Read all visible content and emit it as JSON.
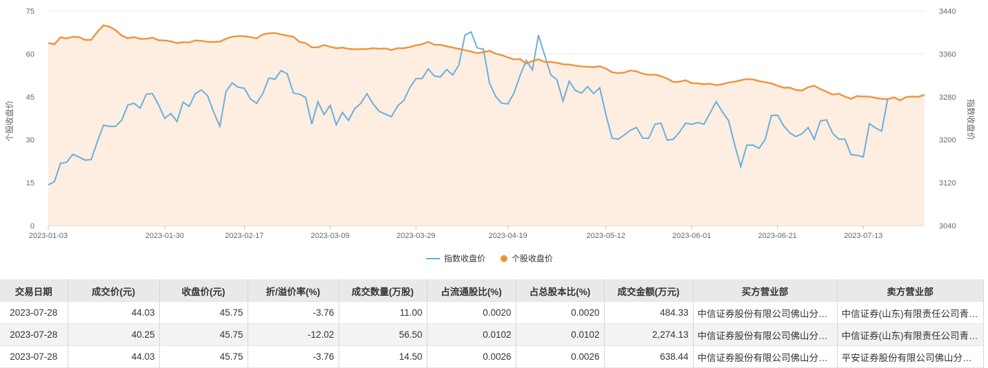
{
  "chart_data": {
    "type": "line",
    "x_tick_labels": [
      "2023-01-03",
      "2023-01-30",
      "2023-02-17",
      "2023-03-09",
      "2023-03-29",
      "2023-04-19",
      "2023-05-12",
      "2023-06-01",
      "2023-06-21",
      "2023-07-13"
    ],
    "y_left": {
      "label": "个股收盘价",
      "ticks": [
        "0",
        "15",
        "30",
        "45",
        "60",
        "75"
      ],
      "range": [
        0,
        75
      ]
    },
    "y_right": {
      "label": "指数收盘价",
      "ticks": [
        "3040",
        "3120",
        "3200",
        "3280",
        "3360",
        "3440"
      ],
      "range": [
        3040,
        3440
      ]
    },
    "grid": true,
    "legend_position": "bottom-center",
    "series": [
      {
        "name": "指数收盘价",
        "axis": "right",
        "color": "#6aaede",
        "values": [
          3116,
          3122,
          3156,
          3158,
          3173,
          3168,
          3162,
          3163,
          3196,
          3227,
          3225,
          3225,
          3237,
          3265,
          3268,
          3259,
          3285,
          3286,
          3265,
          3240,
          3249,
          3234,
          3270,
          3262,
          3286,
          3293,
          3282,
          3251,
          3225,
          3290,
          3306,
          3298,
          3296,
          3276,
          3268,
          3286,
          3315,
          3313,
          3329,
          3323,
          3287,
          3285,
          3279,
          3229,
          3271,
          3247,
          3264,
          3228,
          3251,
          3236,
          3258,
          3268,
          3286,
          3267,
          3253,
          3248,
          3243,
          3263,
          3273,
          3297,
          3314,
          3314,
          3332,
          3319,
          3317,
          3331,
          3321,
          3339,
          3395,
          3401,
          3371,
          3369,
          3306,
          3281,
          3268,
          3267,
          3287,
          3320,
          3348,
          3330,
          3395,
          3358,
          3321,
          3312,
          3272,
          3309,
          3292,
          3287,
          3299,
          3286,
          3297,
          3247,
          3203,
          3201,
          3209,
          3218,
          3223,
          3203,
          3203,
          3229,
          3231,
          3199,
          3201,
          3214,
          3231,
          3229,
          3232,
          3229,
          3250,
          3271,
          3252,
          3236,
          3191,
          3150,
          3190,
          3190,
          3184,
          3201,
          3245,
          3246,
          3226,
          3213,
          3206,
          3211,
          3223,
          3201,
          3235,
          3237,
          3212,
          3201,
          3201,
          3172,
          3171,
          3168,
          3230,
          3222,
          3216,
          3278
        ]
      },
      {
        "name": "个股收盘价",
        "axis": "left",
        "color": "#f0923a",
        "values": [
          63.8,
          63.4,
          65.8,
          65.4,
          66.0,
          65.9,
          64.9,
          64.9,
          67.7,
          70.0,
          69.5,
          68.3,
          66.4,
          65.5,
          65.9,
          65.3,
          65.3,
          65.7,
          64.8,
          64.7,
          64.4,
          63.8,
          64.1,
          64.0,
          64.7,
          64.6,
          64.2,
          64.2,
          64.3,
          65.3,
          66.0,
          66.2,
          66.2,
          65.9,
          65.4,
          66.8,
          67.2,
          67.3,
          66.8,
          66.4,
          66.0,
          64.2,
          63.8,
          62.3,
          62.3,
          63.1,
          62.5,
          62.0,
          62.2,
          61.8,
          61.6,
          61.7,
          61.7,
          62.0,
          61.8,
          61.9,
          61.4,
          62.0,
          62.0,
          62.4,
          63.0,
          63.4,
          64.2,
          63.2,
          63.2,
          62.7,
          62.2,
          61.8,
          61.3,
          60.8,
          60.3,
          60.6,
          61.1,
          60.1,
          59.6,
          58.8,
          58.1,
          58.2,
          56.6,
          57.5,
          58.1,
          57.2,
          57.2,
          56.9,
          56.4,
          56.3,
          55.9,
          55.6,
          55.5,
          55.4,
          55.7,
          54.9,
          53.6,
          53.3,
          53.5,
          54.2,
          53.9,
          53.1,
          52.7,
          52.8,
          52.2,
          51.4,
          50.2,
          50.3,
          50.8,
          49.8,
          49.7,
          49.4,
          49.6,
          49.1,
          49.4,
          50.0,
          50.3,
          50.8,
          51.2,
          51.1,
          50.5,
          50.1,
          49.7,
          48.9,
          48.2,
          48.2,
          47.4,
          47.2,
          48.4,
          48.9,
          47.7,
          46.8,
          45.8,
          46.1,
          45.1,
          44.3,
          45.3,
          45.1,
          45.1,
          44.6,
          44.3,
          44.2,
          44.8,
          43.8,
          44.9,
          45.1,
          45.0,
          45.75
        ]
      }
    ],
    "x_tick_index": [
      0,
      19,
      32,
      46,
      60,
      75,
      91,
      105,
      119,
      133
    ]
  },
  "legend": [
    {
      "label": "指数收盘价",
      "color": "#6aaede",
      "marker": "line"
    },
    {
      "label": "个股收盘价",
      "color": "#f0923a",
      "marker": "dot"
    }
  ],
  "table": {
    "headers": [
      "交易日期",
      "成交价(元)",
      "收盘价(元)",
      "折/溢价率(%)",
      "成交数量(万股)",
      "占流通股比(%)",
      "占总股本比(%)",
      "成交金额(万元)",
      "买方营业部",
      "卖方营业部"
    ],
    "rows": [
      [
        "2023-07-28",
        "44.03",
        "45.75",
        "-3.76",
        "11.00",
        "0.0020",
        "0.0020",
        "484.33",
        "中信证券股份有限公司佛山分行营业部",
        "中信证券(山东)有限责任公司青岛分公司"
      ],
      [
        "2023-07-28",
        "40.25",
        "45.75",
        "-12.02",
        "56.50",
        "0.0102",
        "0.0102",
        "2,274.13",
        "中信证券股份有限公司佛山分行营业部",
        "中信证券(山东)有限责任公司青岛分公司"
      ],
      [
        "2023-07-28",
        "44.03",
        "45.75",
        "-3.76",
        "14.50",
        "0.0026",
        "0.0026",
        "638.44",
        "中信证券股份有限公司佛山分行营业部",
        "平安证券股份有限公司佛山分公司营业部"
      ]
    ]
  }
}
